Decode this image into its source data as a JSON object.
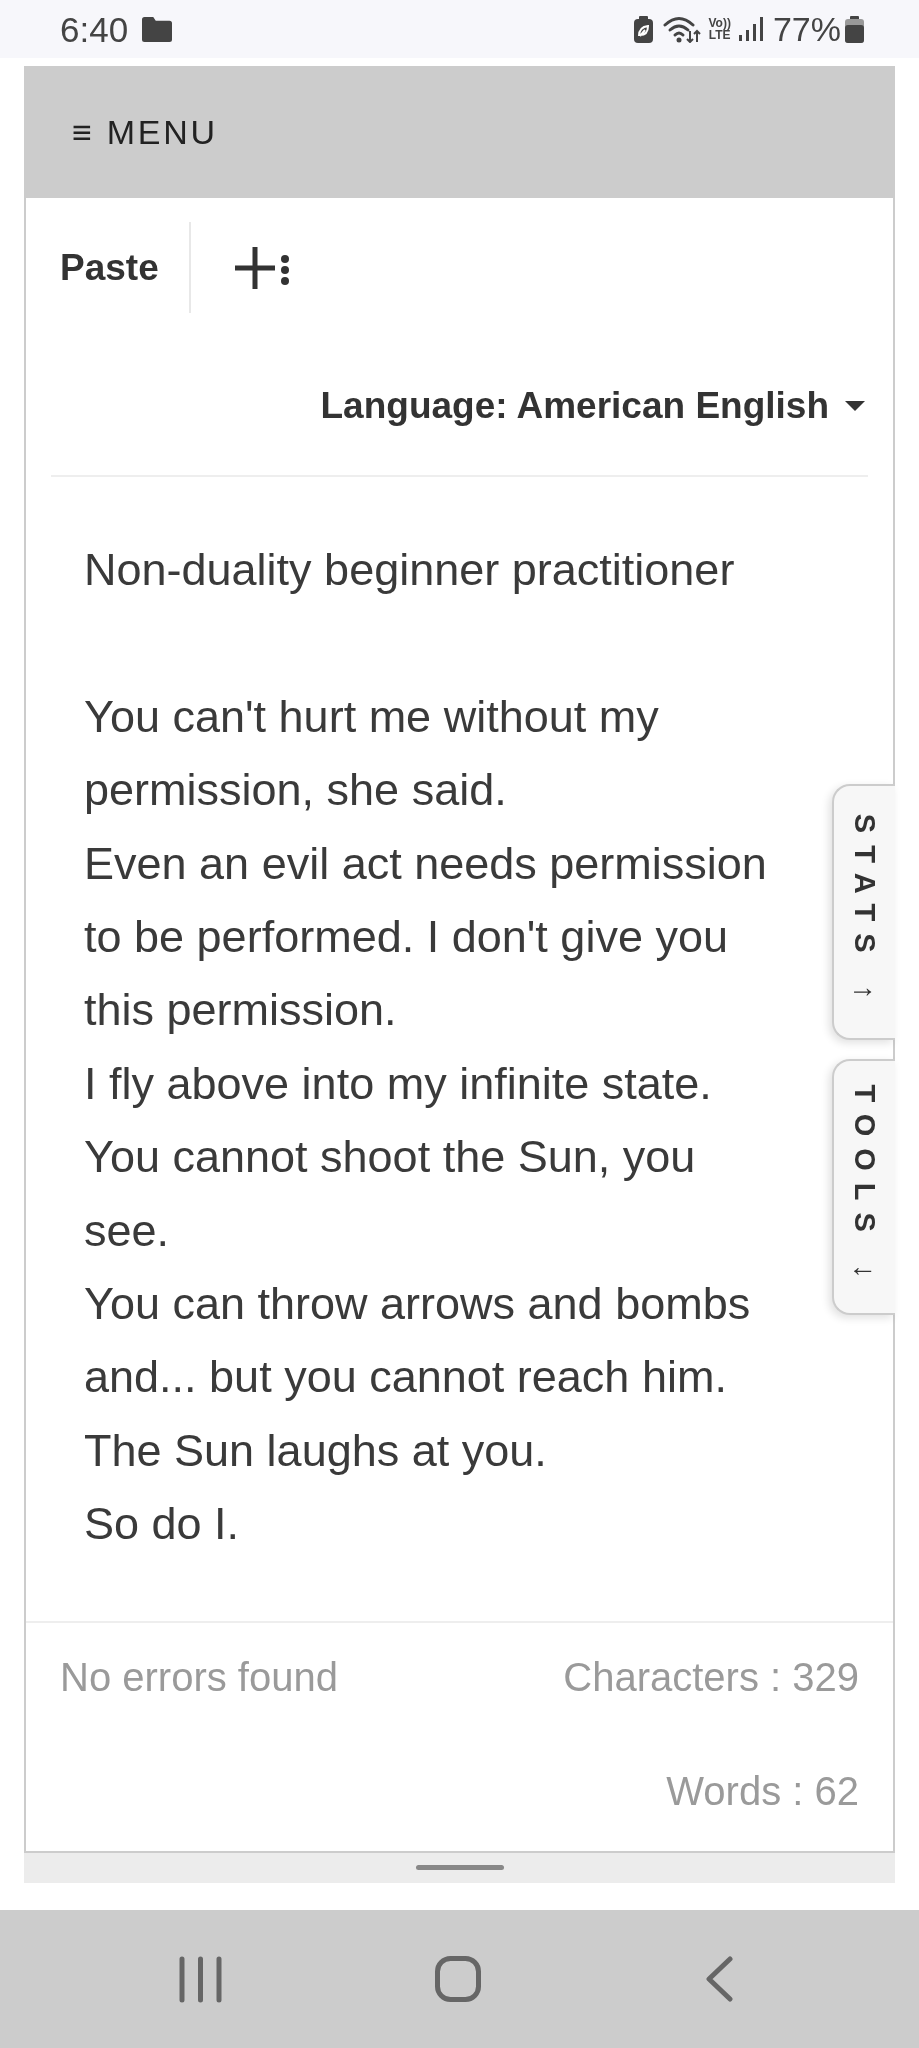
{
  "status_bar": {
    "time": "6:40",
    "network_badge": [
      "Vo))",
      "LTE"
    ],
    "battery": "77%"
  },
  "menu": {
    "label": "≡ MENU"
  },
  "toolbar": {
    "paste": "Paste"
  },
  "language": {
    "label": "Language: American English"
  },
  "editor": {
    "text": "Non-duality beginner practitioner\n\nYou can't hurt me without my permission, she said.\nEven an evil act needs permission to be performed. I don't give you this permission.\nI fly above into my infinite state.\nYou cannot shoot the Sun, you see.\nYou can throw arrows and bombs and... but you cannot reach him.\nThe Sun laughs at you.\nSo do I."
  },
  "side_tabs": [
    {
      "label": "STATS ↑"
    },
    {
      "label": "TOOLS ↓"
    }
  ],
  "footer": {
    "status": "No errors found",
    "characters": "Characters : 329",
    "words": "Words : 62"
  }
}
